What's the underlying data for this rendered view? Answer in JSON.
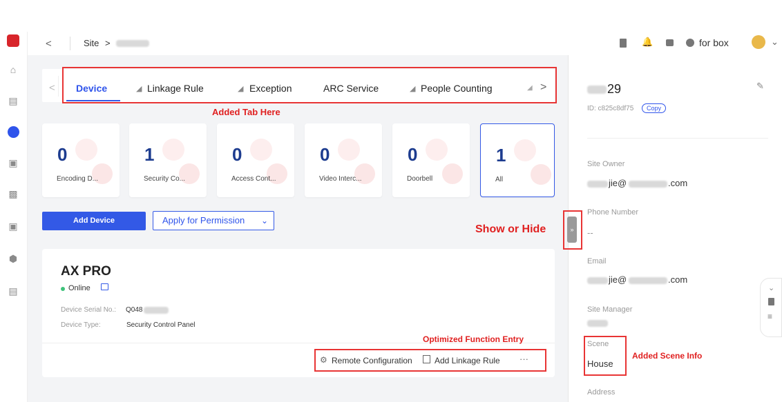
{
  "header": {
    "site_label": "Site",
    "breadcrumb_sep": ">",
    "back": "<",
    "account": "for box"
  },
  "tabs": {
    "items": [
      "Device",
      "Linkage Rule",
      "Exception",
      "ARC Service",
      "People Counting"
    ],
    "prev": "<",
    "next": ">"
  },
  "cards": [
    {
      "count": "0",
      "label": "Encoding D..."
    },
    {
      "count": "1",
      "label": "Security Co..."
    },
    {
      "count": "0",
      "label": "Access Cont..."
    },
    {
      "count": "0",
      "label": "Video Interc..."
    },
    {
      "count": "0",
      "label": "Doorbell"
    },
    {
      "count": "1",
      "label": "All"
    }
  ],
  "actions": {
    "add_device": "Add Device",
    "apply_permission": "Apply for Permission"
  },
  "device": {
    "name": "AX PRO",
    "status": "Online",
    "serial_label": "Device Serial No.:",
    "serial_value": "Q048",
    "type_label": "Device Type:",
    "type_value": "Security Control Panel",
    "remote_config": "Remote Configuration",
    "add_linkage": "Add Linkage Rule",
    "more": "···"
  },
  "annotations": {
    "added_tab": "Added Tab Here",
    "show_hide": "Show or Hide",
    "optimized": "Optimized Function Entry",
    "scene_info": "Added Scene Info"
  },
  "site_info": {
    "name_suffix": "29",
    "id": "ID: c825c8df75",
    "copy": "Copy",
    "owner_label": "Site Owner",
    "owner_value_prefix": "jie@",
    "owner_value_suffix": ".com",
    "phone_label": "Phone Number",
    "phone_value": "--",
    "email_label": "Email",
    "email_value_prefix": "jie@",
    "email_value_suffix": ".com",
    "manager_label": "Site Manager",
    "scene_label": "Scene",
    "scene_value": "House",
    "address_label": "Address"
  },
  "colors": {
    "accent": "#3359e6",
    "annotation": "#e83434",
    "online": "#3ec27a"
  }
}
